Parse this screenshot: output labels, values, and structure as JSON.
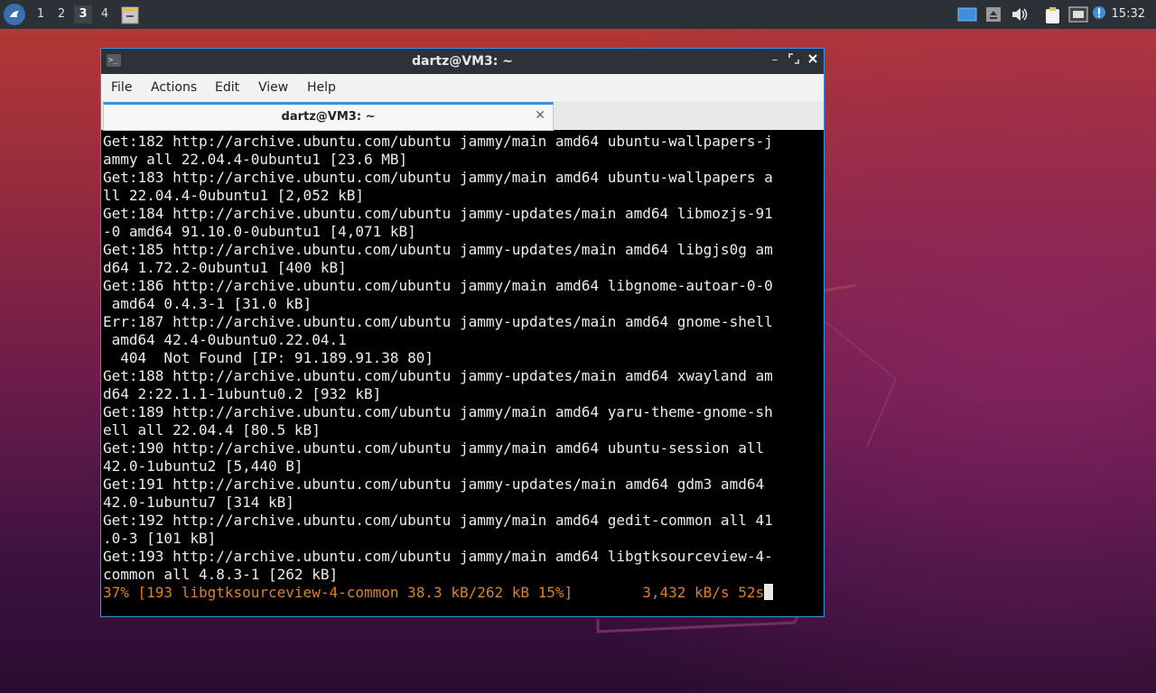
{
  "panel": {
    "workspaces": [
      "1",
      "2",
      "3",
      "4"
    ],
    "active_workspace": "3",
    "clock": "15:32"
  },
  "window": {
    "title": "dartz@VM3: ~",
    "menu": [
      "File",
      "Actions",
      "Edit",
      "View",
      "Help"
    ],
    "tab_title": "dartz@VM3: ~"
  },
  "terminal": {
    "lines": [
      "Get:182 http://archive.ubuntu.com/ubuntu jammy/main amd64 ubuntu-wallpapers-j",
      "ammy all 22.04.4-0ubuntu1 [23.6 MB]",
      "Get:183 http://archive.ubuntu.com/ubuntu jammy/main amd64 ubuntu-wallpapers a",
      "ll 22.04.4-0ubuntu1 [2,052 kB]",
      "Get:184 http://archive.ubuntu.com/ubuntu jammy-updates/main amd64 libmozjs-91",
      "-0 amd64 91.10.0-0ubuntu1 [4,071 kB]",
      "Get:185 http://archive.ubuntu.com/ubuntu jammy-updates/main amd64 libgjs0g am",
      "d64 1.72.2-0ubuntu1 [400 kB]",
      "Get:186 http://archive.ubuntu.com/ubuntu jammy/main amd64 libgnome-autoar-0-0",
      " amd64 0.4.3-1 [31.0 kB]",
      "Err:187 http://archive.ubuntu.com/ubuntu jammy-updates/main amd64 gnome-shell",
      " amd64 42.4-0ubuntu0.22.04.1",
      "  404  Not Found [IP: 91.189.91.38 80]",
      "Get:188 http://archive.ubuntu.com/ubuntu jammy-updates/main amd64 xwayland am",
      "d64 2:22.1.1-1ubuntu0.2 [932 kB]",
      "Get:189 http://archive.ubuntu.com/ubuntu jammy/main amd64 yaru-theme-gnome-sh",
      "ell all 22.04.4 [80.5 kB]",
      "Get:190 http://archive.ubuntu.com/ubuntu jammy/main amd64 ubuntu-session all",
      "42.0-1ubuntu2 [5,440 B]",
      "Get:191 http://archive.ubuntu.com/ubuntu jammy-updates/main amd64 gdm3 amd64",
      "42.0-1ubuntu7 [314 kB]",
      "Get:192 http://archive.ubuntu.com/ubuntu jammy/main amd64 gedit-common all 41",
      ".0-3 [101 kB]",
      "Get:193 http://archive.ubuntu.com/ubuntu jammy/main amd64 libgtksourceview-4-",
      "common all 4.8.3-1 [262 kB]"
    ],
    "progress_line": "37% [193 libgtksourceview-4-common 38.3 kB/262 kB 15%]        3,432 kB/s 52s"
  },
  "colors": {
    "accent": "#3d8fe0",
    "progress": "#d9822b",
    "terminal_bg": "#000000",
    "terminal_fg": "#ededed"
  }
}
